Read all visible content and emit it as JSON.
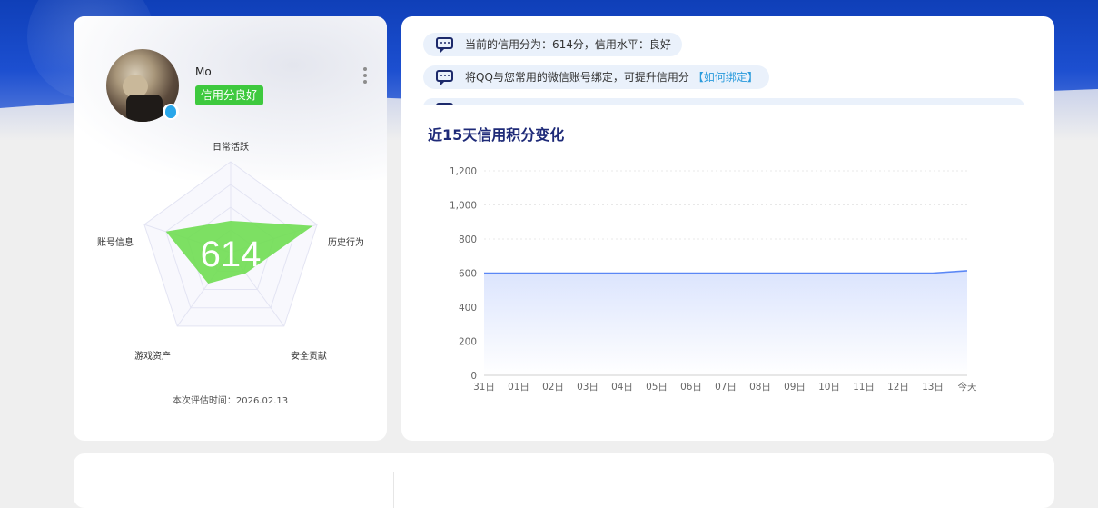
{
  "profile": {
    "username": "Mo",
    "credit_badge": "信用分良好",
    "score": "614",
    "eval_time": "本次评估时间：2026.02.13",
    "radar_axes": [
      "日常活跃",
      "历史行为",
      "安全贡献",
      "游戏资产",
      "账号信息"
    ]
  },
  "tips": {
    "tip1": "当前的信用分为：614分，信用水平：良好",
    "tip2": "将QQ与您常用的微信账号绑定，可提升信用分",
    "tip2_link": "【如何绑定】"
  },
  "chart_data": {
    "type": "area",
    "title": "近15天信用积分变化",
    "categories": [
      "31日",
      "01日",
      "02日",
      "03日",
      "04日",
      "05日",
      "06日",
      "07日",
      "08日",
      "09日",
      "10日",
      "11日",
      "12日",
      "13日",
      "今天"
    ],
    "values": [
      600,
      600,
      600,
      600,
      600,
      600,
      600,
      600,
      600,
      600,
      600,
      600,
      600,
      600,
      614
    ],
    "y_ticks": [
      "0",
      "200",
      "400",
      "600",
      "800",
      "1,000",
      "1,200"
    ],
    "ylim": [
      0,
      1200
    ],
    "grid": true,
    "line_color": "#5b87f5"
  },
  "colors": {
    "banner": "#1c4fd0",
    "badge": "#3ec93e",
    "radar_fill": "#6fdd52",
    "title": "#1e2a78"
  }
}
